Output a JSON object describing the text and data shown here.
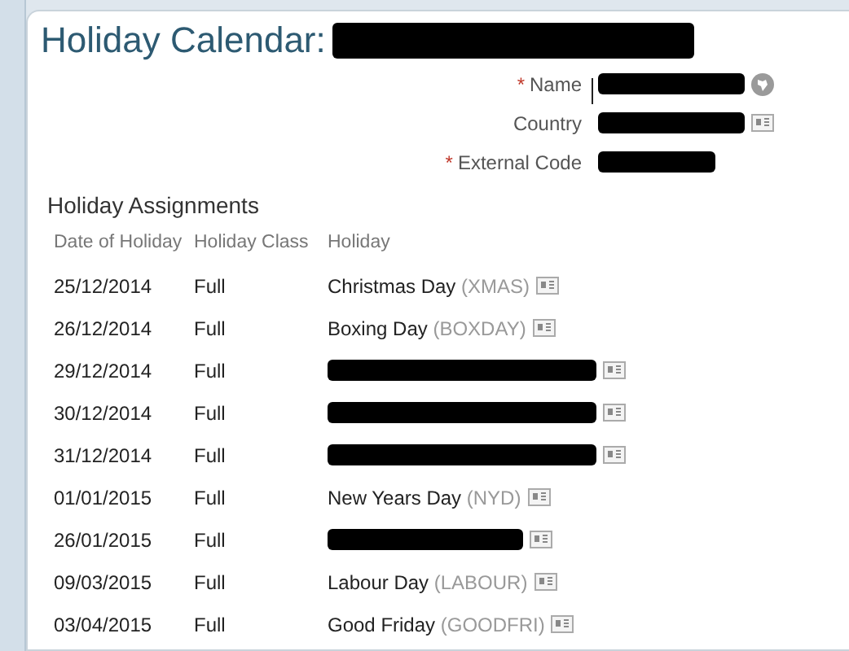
{
  "title": "Holiday Calendar:",
  "fields": [
    {
      "label": "Name",
      "required_mark": "*"
    },
    {
      "label": "Country"
    },
    {
      "label": "External Code",
      "required_mark": "*"
    }
  ],
  "section_title": "Holiday Assignments",
  "table": {
    "columns": [
      "Date of Holiday",
      "Holiday Class",
      "Holiday"
    ],
    "rows": [
      {
        "date": "25/12/2014",
        "class": "Full",
        "holiday": {
          "kind": "named",
          "name": "Christmas Day",
          "code": "(XMAS)"
        }
      },
      {
        "date": "26/12/2014",
        "class": "Full",
        "holiday": {
          "kind": "named",
          "name": "Boxing Day",
          "code": "(BOXDAY)"
        }
      },
      {
        "date": "29/12/2014",
        "class": "Full",
        "holiday": {
          "kind": "redacted"
        }
      },
      {
        "date": "30/12/2014",
        "class": "Full",
        "holiday": {
          "kind": "redacted"
        }
      },
      {
        "date": "31/12/2014",
        "class": "Full",
        "holiday": {
          "kind": "redacted"
        }
      },
      {
        "date": "01/01/2015",
        "class": "Full",
        "holiday": {
          "kind": "named",
          "name": "New Years Day",
          "code": "(NYD)"
        }
      },
      {
        "date": "26/01/2015",
        "class": "Full",
        "holiday": {
          "kind": "redacted"
        }
      },
      {
        "date": "09/03/2015",
        "class": "Full",
        "holiday": {
          "kind": "named",
          "name": "Labour Day",
          "code": "(LABOUR)"
        }
      },
      {
        "date": "03/04/2015",
        "class": "Full",
        "holiday": {
          "kind": "named",
          "name": "Good Friday",
          "code": "(GOODFRI)"
        }
      }
    ]
  }
}
